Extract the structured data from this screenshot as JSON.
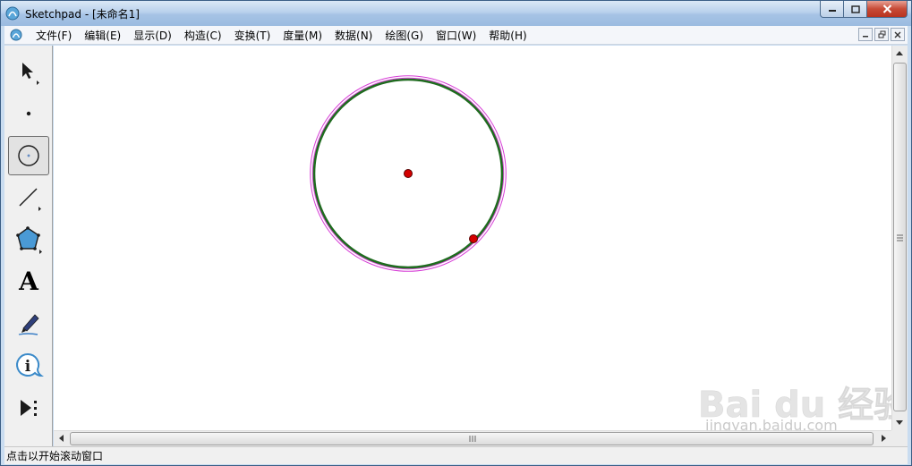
{
  "window": {
    "title": "Sketchpad - [未命名1]",
    "controls": {
      "minimize": "minimize",
      "maximize": "maximize",
      "close": "close"
    }
  },
  "menubar": {
    "items": [
      {
        "label": "文件(F)"
      },
      {
        "label": "编辑(E)"
      },
      {
        "label": "显示(D)"
      },
      {
        "label": "构造(C)"
      },
      {
        "label": "变换(T)"
      },
      {
        "label": "度量(M)"
      },
      {
        "label": "数据(N)"
      },
      {
        "label": "绘图(G)"
      },
      {
        "label": "窗口(W)"
      },
      {
        "label": "帮助(H)"
      }
    ]
  },
  "toolbox": {
    "tools": [
      {
        "name": "selection-arrow-tool",
        "icon": "arrow-icon"
      },
      {
        "name": "point-tool",
        "icon": "point-icon"
      },
      {
        "name": "compass-tool",
        "icon": "circle-icon",
        "active": true
      },
      {
        "name": "straightedge-tool",
        "icon": "line-icon"
      },
      {
        "name": "polygon-tool",
        "icon": "polygon-icon"
      },
      {
        "name": "text-tool",
        "icon": "text-icon",
        "glyph": "A"
      },
      {
        "name": "marker-tool",
        "icon": "marker-icon"
      },
      {
        "name": "information-tool",
        "icon": "info-icon",
        "glyph": "i"
      },
      {
        "name": "custom-tool",
        "icon": "custom-tool-icon"
      }
    ]
  },
  "canvas": {
    "colors": {
      "circle": "#1f6b1f",
      "circle_highlight": "#d63cd6",
      "point": "#d40000"
    }
  },
  "statusbar": {
    "text": "点击以开始滚动窗口"
  },
  "watermark": {
    "logo_text": "Bai du 经验",
    "url": "jingyan.baidu.com"
  }
}
